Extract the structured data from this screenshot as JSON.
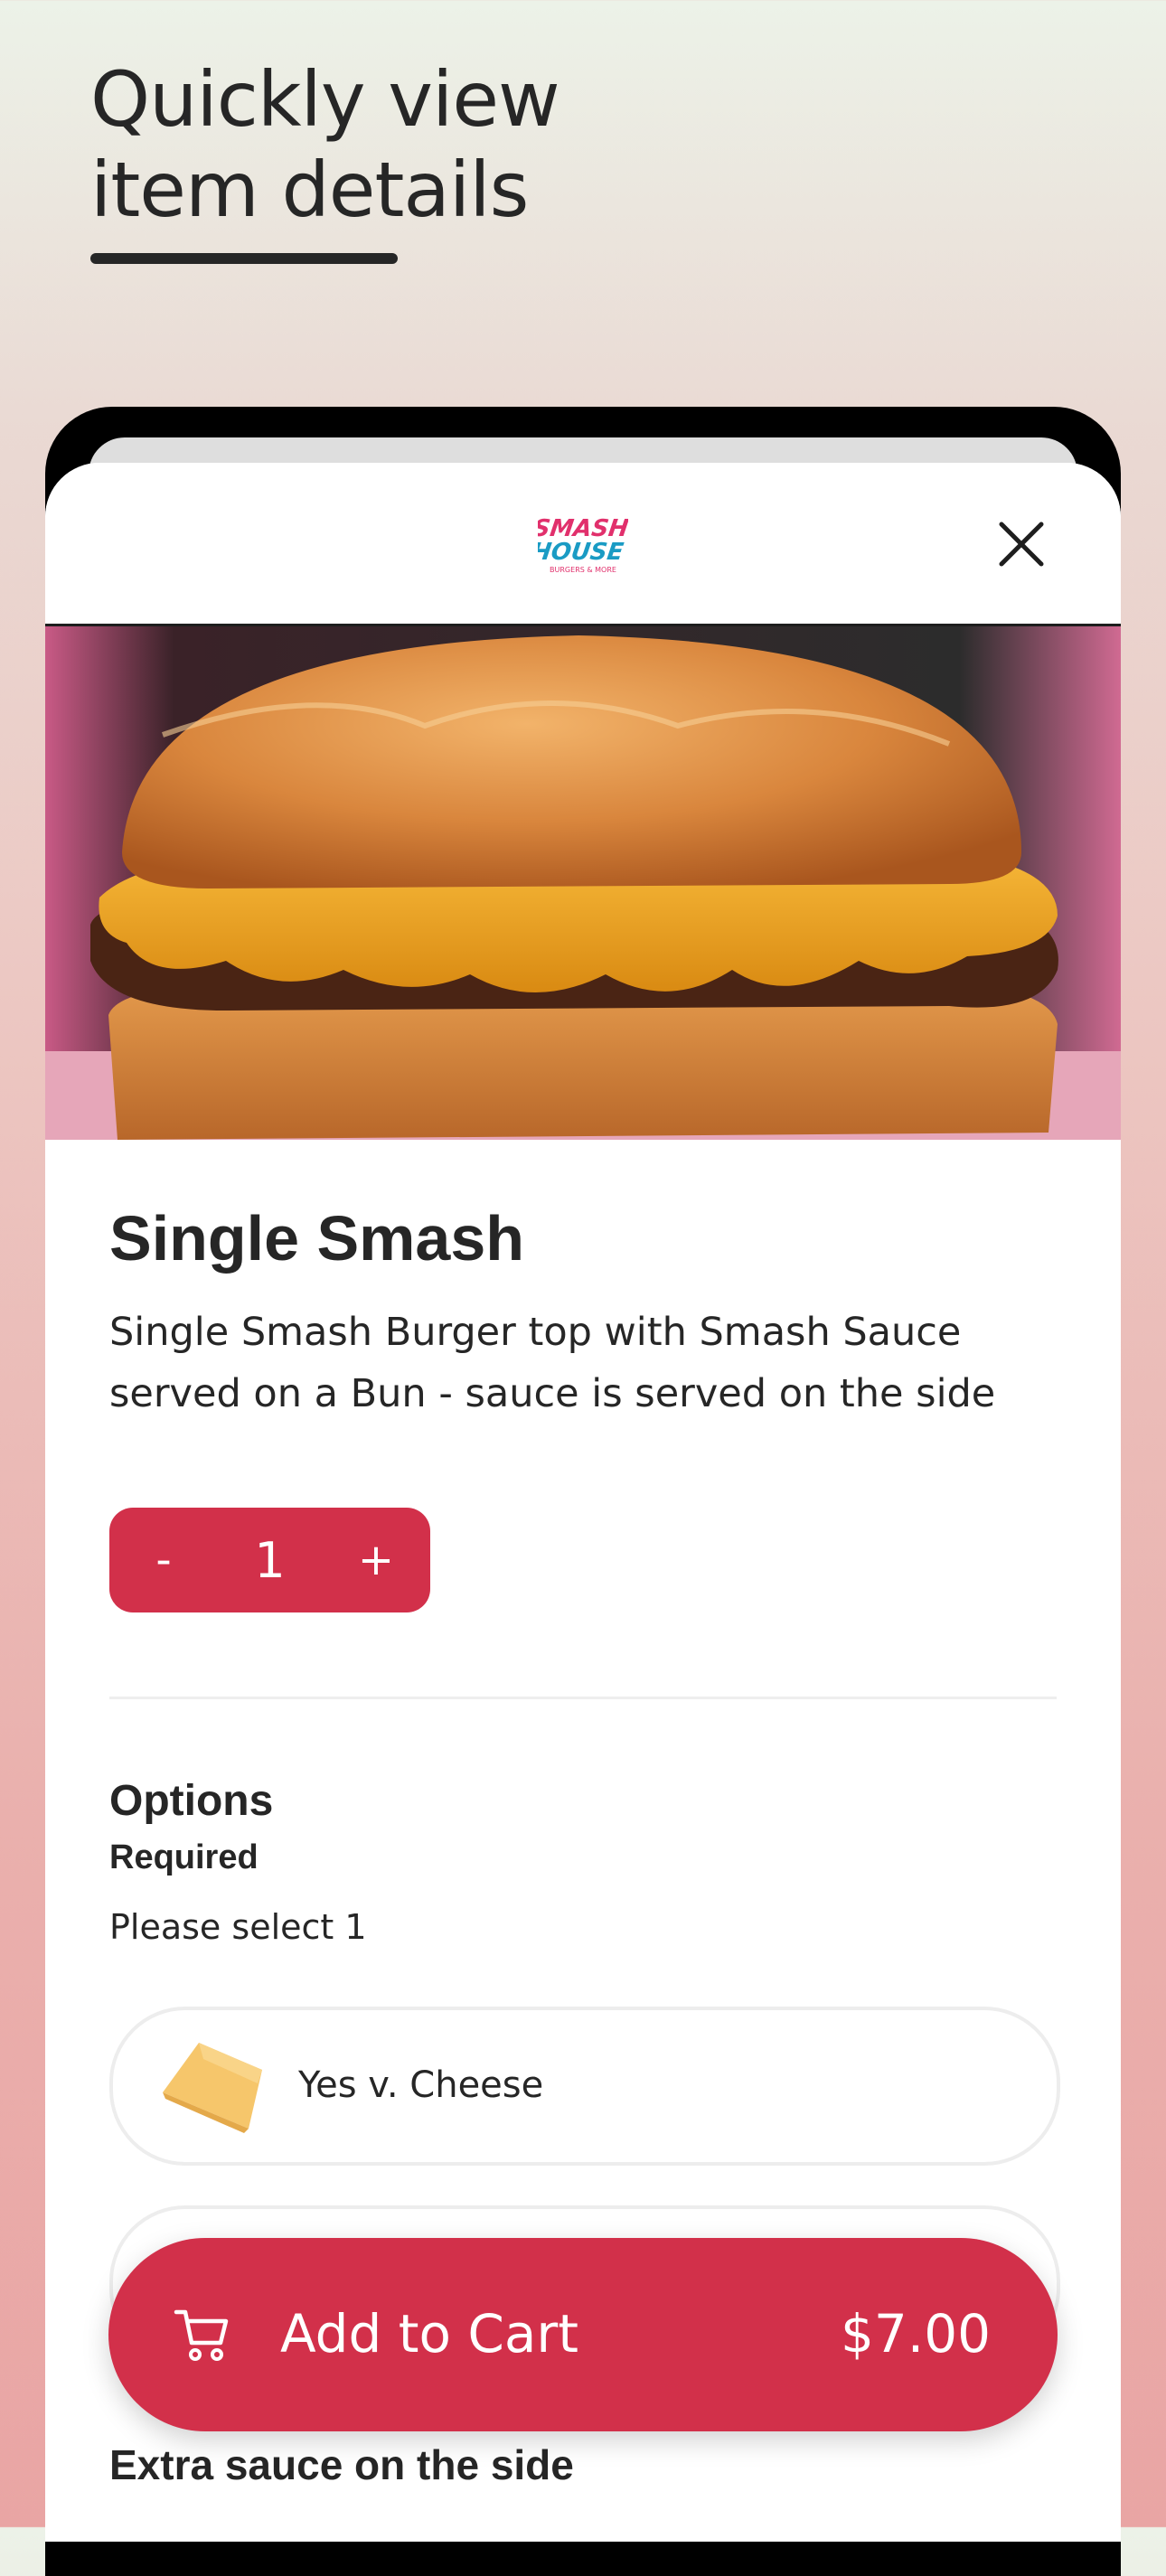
{
  "headline": {
    "text": "Quickly view item details"
  },
  "modal": {
    "logo_text_line1": "SMASH",
    "logo_text_line2": "HOUSE",
    "logo_text_line3": "BURGERS & MORE",
    "close_icon": "close-icon",
    "hero_image": "burger-photo"
  },
  "item": {
    "title": "Single Smash",
    "description": "Single Smash Burger top with Smash Sauce served on a Bun - sauce is served on the side"
  },
  "stepper": {
    "minus_label": "-",
    "quantity": "1",
    "plus_label": "+"
  },
  "options": {
    "title": "Options",
    "required_label": "Required",
    "select_hint": "Please select 1",
    "items": [
      {
        "label": "Yes v. Cheese",
        "icon": "cheese-slice-icon"
      },
      {
        "label": "",
        "icon": "option-thumbnail"
      }
    ]
  },
  "next_section": {
    "title": "Extra sauce on the side"
  },
  "cart": {
    "label": "Add to Cart",
    "price": "$7.00",
    "icon": "cart-icon"
  },
  "colors": {
    "accent": "#d2304a",
    "text": "#262626",
    "logo_pink": "#e1306c",
    "logo_blue": "#1a9bc4"
  }
}
